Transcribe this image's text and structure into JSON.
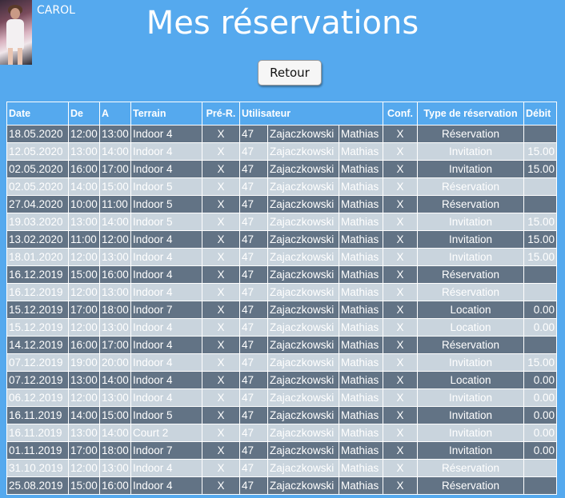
{
  "user": {
    "name": "CAROL"
  },
  "header": {
    "title": "Mes réservations"
  },
  "back_button": {
    "label": "Retour"
  },
  "colors": {
    "background": "#55a9ee",
    "row_dark": "#627385",
    "row_light": "#c9d4dd",
    "text": "#ffffff"
  },
  "table": {
    "headers": [
      "Date",
      "De",
      "A",
      "Terrain",
      "Pré-R.",
      "Utilisateur",
      "Conf.",
      "Type de réservation",
      "Débit"
    ],
    "rows": [
      {
        "date": "18.05.2020",
        "de": "12:00",
        "a": "13:00",
        "terrain": "Indoor 4",
        "pre": "X",
        "num": "47",
        "nom": "Zajaczkowski",
        "prenom": "Mathias",
        "conf": "X",
        "type": "Réservation",
        "debit": ""
      },
      {
        "date": "12.05.2020",
        "de": "13:00",
        "a": "14:00",
        "terrain": "Indoor 4",
        "pre": "X",
        "num": "47",
        "nom": "Zajaczkowski",
        "prenom": "Mathias",
        "conf": "X",
        "type": "Invitation",
        "debit": "15.00"
      },
      {
        "date": "02.05.2020",
        "de": "16:00",
        "a": "17:00",
        "terrain": "Indoor 4",
        "pre": "X",
        "num": "47",
        "nom": "Zajaczkowski",
        "prenom": "Mathias",
        "conf": "X",
        "type": "Invitation",
        "debit": "15.00"
      },
      {
        "date": "02.05.2020",
        "de": "14:00",
        "a": "15:00",
        "terrain": "Indoor 5",
        "pre": "X",
        "num": "47",
        "nom": "Zajaczkowski",
        "prenom": "Mathias",
        "conf": "X",
        "type": "Réservation",
        "debit": ""
      },
      {
        "date": "27.04.2020",
        "de": "10:00",
        "a": "11:00",
        "terrain": "Indoor 5",
        "pre": "X",
        "num": "47",
        "nom": "Zajaczkowski",
        "prenom": "Mathias",
        "conf": "X",
        "type": "Réservation",
        "debit": ""
      },
      {
        "date": "19.03.2020",
        "de": "13:00",
        "a": "14:00",
        "terrain": "Indoor 5",
        "pre": "X",
        "num": "47",
        "nom": "Zajaczkowski",
        "prenom": "Mathias",
        "conf": "X",
        "type": "Invitation",
        "debit": "15.00"
      },
      {
        "date": "13.02.2020",
        "de": "11:00",
        "a": "12:00",
        "terrain": "Indoor 4",
        "pre": "X",
        "num": "47",
        "nom": "Zajaczkowski",
        "prenom": "Mathias",
        "conf": "X",
        "type": "Invitation",
        "debit": "15.00"
      },
      {
        "date": "18.01.2020",
        "de": "12:00",
        "a": "13:00",
        "terrain": "Indoor 4",
        "pre": "X",
        "num": "47",
        "nom": "Zajaczkowski",
        "prenom": "Mathias",
        "conf": "X",
        "type": "Invitation",
        "debit": "15.00"
      },
      {
        "date": "16.12.2019",
        "de": "15:00",
        "a": "16:00",
        "terrain": "Indoor 4",
        "pre": "X",
        "num": "47",
        "nom": "Zajaczkowski",
        "prenom": "Mathias",
        "conf": "X",
        "type": "Réservation",
        "debit": ""
      },
      {
        "date": "16.12.2019",
        "de": "12:00",
        "a": "13:00",
        "terrain": "Indoor 4",
        "pre": "X",
        "num": "47",
        "nom": "Zajaczkowski",
        "prenom": "Mathias",
        "conf": "X",
        "type": "Réservation",
        "debit": ""
      },
      {
        "date": "15.12.2019",
        "de": "17:00",
        "a": "18:00",
        "terrain": "Indoor 7",
        "pre": "X",
        "num": "47",
        "nom": "Zajaczkowski",
        "prenom": "Mathias",
        "conf": "X",
        "type": "Location",
        "debit": "0.00"
      },
      {
        "date": "15.12.2019",
        "de": "12:00",
        "a": "13:00",
        "terrain": "Indoor 4",
        "pre": "X",
        "num": "47",
        "nom": "Zajaczkowski",
        "prenom": "Mathias",
        "conf": "X",
        "type": "Location",
        "debit": "0.00"
      },
      {
        "date": "14.12.2019",
        "de": "16:00",
        "a": "17:00",
        "terrain": "Indoor 4",
        "pre": "X",
        "num": "47",
        "nom": "Zajaczkowski",
        "prenom": "Mathias",
        "conf": "X",
        "type": "Réservation",
        "debit": ""
      },
      {
        "date": "07.12.2019",
        "de": "19:00",
        "a": "20:00",
        "terrain": "Indoor 4",
        "pre": "X",
        "num": "47",
        "nom": "Zajaczkowski",
        "prenom": "Mathias",
        "conf": "X",
        "type": "Invitation",
        "debit": "15.00"
      },
      {
        "date": "07.12.2019",
        "de": "13:00",
        "a": "14:00",
        "terrain": "Indoor 4",
        "pre": "X",
        "num": "47",
        "nom": "Zajaczkowski",
        "prenom": "Mathias",
        "conf": "X",
        "type": "Location",
        "debit": "0.00"
      },
      {
        "date": "06.12.2019",
        "de": "12:00",
        "a": "13:00",
        "terrain": "Indoor 4",
        "pre": "X",
        "num": "47",
        "nom": "Zajaczkowski",
        "prenom": "Mathias",
        "conf": "X",
        "type": "Invitation",
        "debit": "0.00"
      },
      {
        "date": "16.11.2019",
        "de": "14:00",
        "a": "15:00",
        "terrain": "Indoor 5",
        "pre": "X",
        "num": "47",
        "nom": "Zajaczkowski",
        "prenom": "Mathias",
        "conf": "X",
        "type": "Invitation",
        "debit": "0.00"
      },
      {
        "date": "16.11.2019",
        "de": "13:00",
        "a": "14:00",
        "terrain": "Court 2",
        "pre": "X",
        "num": "47",
        "nom": "Zajaczkowski",
        "prenom": "Mathias",
        "conf": "X",
        "type": "Invitation",
        "debit": "0.00"
      },
      {
        "date": "01.11.2019",
        "de": "17:00",
        "a": "18:00",
        "terrain": "Indoor 7",
        "pre": "X",
        "num": "47",
        "nom": "Zajaczkowski",
        "prenom": "Mathias",
        "conf": "X",
        "type": "Invitation",
        "debit": "0.00"
      },
      {
        "date": "31.10.2019",
        "de": "12:00",
        "a": "13:00",
        "terrain": "Indoor 4",
        "pre": "X",
        "num": "47",
        "nom": "Zajaczkowski",
        "prenom": "Mathias",
        "conf": "X",
        "type": "Réservation",
        "debit": ""
      },
      {
        "date": "25.08.2019",
        "de": "15:00",
        "a": "16:00",
        "terrain": "Indoor 4",
        "pre": "X",
        "num": "47",
        "nom": "Zajaczkowski",
        "prenom": "Mathias",
        "conf": "X",
        "type": "Réservation",
        "debit": ""
      }
    ]
  }
}
